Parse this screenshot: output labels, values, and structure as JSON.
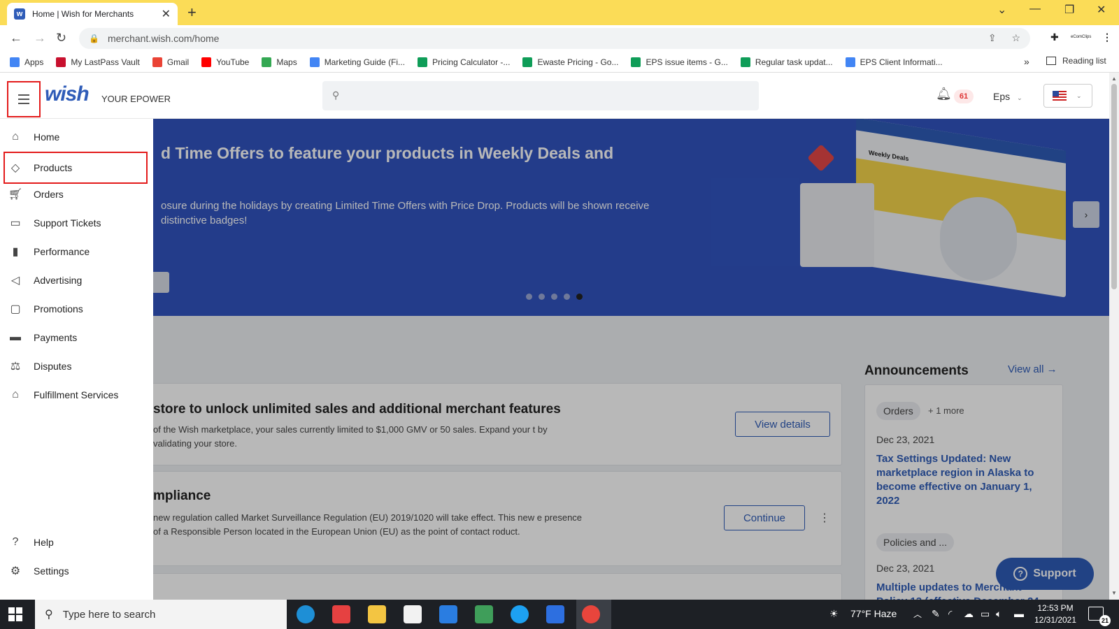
{
  "browser": {
    "tab_title": "Home | Wish for Merchants",
    "favicon_letter": "w",
    "url": "merchant.wish.com/home",
    "extension_label": "eComClips",
    "bookmarks": [
      {
        "label": "Apps",
        "icon": "apps-grid-icon",
        "color": "#4285f4"
      },
      {
        "label": "My LastPass Vault",
        "icon": "lastpass-icon",
        "color": "#c8102e"
      },
      {
        "label": "Gmail",
        "icon": "gmail-icon",
        "color": "#ea4335"
      },
      {
        "label": "YouTube",
        "icon": "youtube-icon",
        "color": "#ff0000"
      },
      {
        "label": "Maps",
        "icon": "maps-icon",
        "color": "#34a853"
      },
      {
        "label": "Marketing Guide (Fi...",
        "icon": "google-icon",
        "color": "#4285f4"
      },
      {
        "label": "Pricing Calculator -...",
        "icon": "sheets-icon",
        "color": "#0f9d58"
      },
      {
        "label": "Ewaste Pricing - Go...",
        "icon": "sheets-icon",
        "color": "#0f9d58"
      },
      {
        "label": "EPS issue items - G...",
        "icon": "sheets-icon",
        "color": "#0f9d58"
      },
      {
        "label": "Regular task updat...",
        "icon": "sheets-icon",
        "color": "#0f9d58"
      },
      {
        "label": "EPS Client Informati...",
        "icon": "docs-icon",
        "color": "#4285f4"
      }
    ],
    "more_bookmarks": "»",
    "reading_list": "Reading list"
  },
  "header": {
    "logo": "wish",
    "store_name": "YOUR EPOWER",
    "search_placeholder": "",
    "notification_count": "61",
    "user_name": "Eps",
    "locale_flag": "us-flag-icon"
  },
  "sidebar": {
    "items": [
      {
        "label": "Home",
        "icon": "home-icon"
      },
      {
        "label": "Products",
        "icon": "tag-icon"
      },
      {
        "label": "Orders",
        "icon": "cart-icon"
      },
      {
        "label": "Support Tickets",
        "icon": "chat-icon"
      },
      {
        "label": "Performance",
        "icon": "bar-chart-icon"
      },
      {
        "label": "Advertising",
        "icon": "megaphone-icon"
      },
      {
        "label": "Promotions",
        "icon": "ticket-icon"
      },
      {
        "label": "Payments",
        "icon": "credit-card-icon"
      },
      {
        "label": "Disputes",
        "icon": "gavel-icon"
      },
      {
        "label": "Fulfillment Services",
        "icon": "warehouse-icon"
      }
    ],
    "footer_items": [
      {
        "label": "Help",
        "icon": "help-icon"
      },
      {
        "label": "Settings",
        "icon": "gear-icon"
      }
    ]
  },
  "banner": {
    "title": "d Time Offers to feature your products in Weekly Deals and",
    "text": "osure during the holidays by creating Limited Time Offers with Price Drop. Products will be shown receive distinctive badges!",
    "art_label": "Weekly Deals",
    "slides": 5,
    "active_slide": 5
  },
  "cards": [
    {
      "title": "store to unlock unlimited sales and additional merchant features",
      "text": "of the Wish marketplace, your sales currently limited to $1,000 GMV or 50 sales. Expand your t by validating your store.",
      "button": "View details"
    },
    {
      "title": "mpliance",
      "text": "new regulation called Market Surveillance Regulation (EU) 2019/1020 will take effect. This new e presence of a Responsible Person located in the European Union (EU) as the point of contact roduct.",
      "button": "Continue"
    }
  ],
  "announcements": {
    "title": "Announcements",
    "view_all": "View all →",
    "items": [
      {
        "tag": "Orders",
        "more": "+ 1 more",
        "date": "Dec 23, 2021",
        "headline": "Tax Settings Updated: New marketplace region in Alaska to become effective on January 1, 2022"
      },
      {
        "tag": "Policies and ...",
        "more": "",
        "date": "Dec 23, 2021",
        "headline": "Multiple updates to Merchant Policy 13 (effective December 24"
      }
    ]
  },
  "support_button": "Support",
  "taskbar": {
    "search_placeholder": "Type here to search",
    "weather": "77°F  Haze",
    "time": "12:53 PM",
    "date": "12/31/2021",
    "notifications": "21",
    "apps": [
      {
        "icon": "edge-icon",
        "color": "#1e8fd6"
      },
      {
        "icon": "anydesk-icon",
        "color": "#e64141"
      },
      {
        "icon": "file-explorer-icon",
        "color": "#f3c542"
      },
      {
        "icon": "store-icon",
        "color": "#f2f2f2"
      },
      {
        "icon": "mail-icon",
        "color": "#2a7de1"
      },
      {
        "icon": "excel-icon",
        "color": "#3f9e5a"
      },
      {
        "icon": "skype-icon",
        "color": "#1da1f2"
      },
      {
        "icon": "app-icon",
        "color": "#2d6fe0"
      },
      {
        "icon": "chrome-icon",
        "color": "#e8453c"
      }
    ]
  },
  "colors": {
    "brand_blue": "#2f5cb8",
    "highlight_red": "#e31b1b",
    "chrome_tab_bar": "#fbdc57",
    "banner_blue": "#3154c0"
  }
}
